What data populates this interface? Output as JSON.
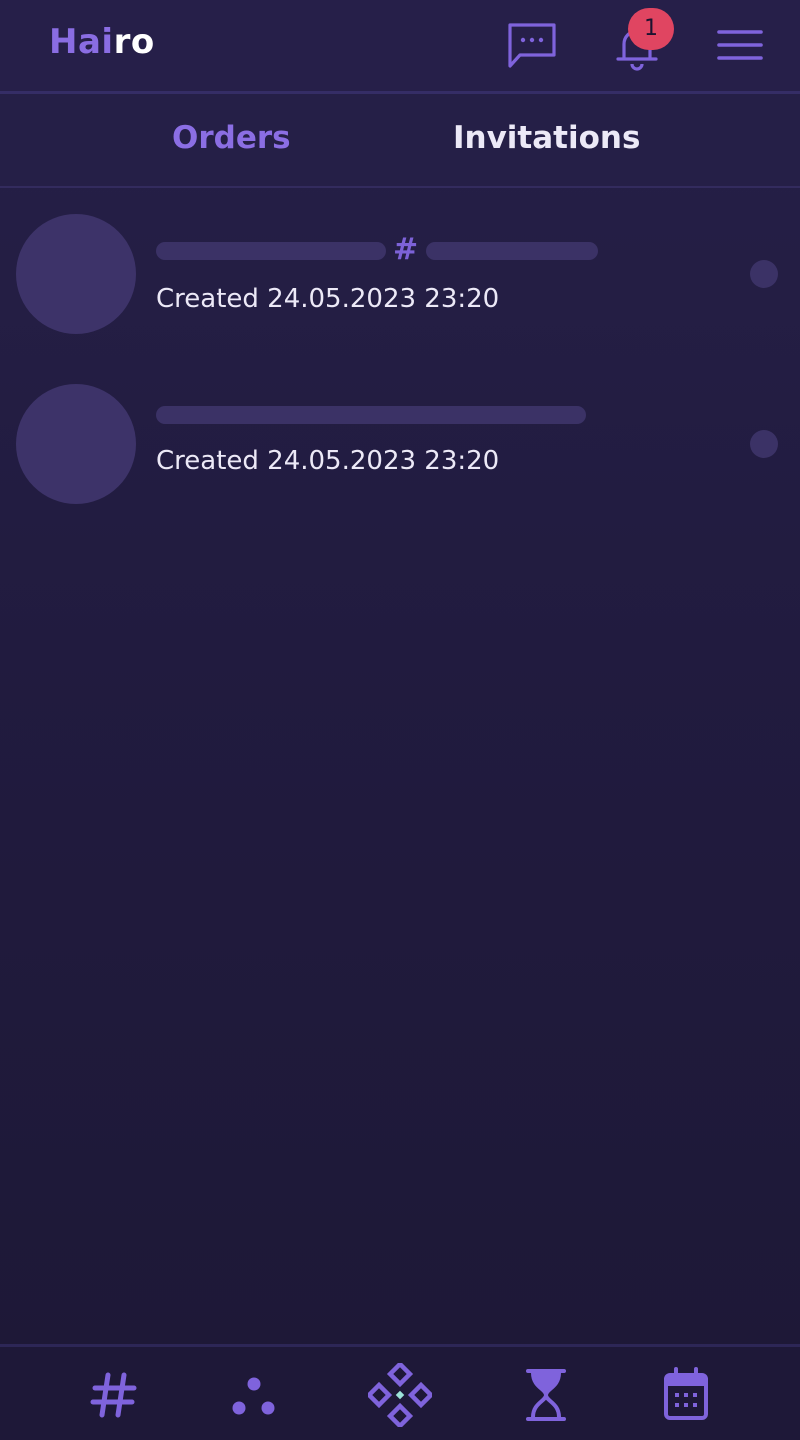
{
  "header": {
    "logo_part1": "Hai",
    "logo_part2": "ro",
    "chat_icon": "chat-bubble-icon",
    "bell_icon": "bell-icon",
    "menu_icon": "hamburger-menu-icon",
    "notification_count": "1"
  },
  "tabs": [
    {
      "label": "Orders",
      "active": true
    },
    {
      "label": "Invitations",
      "active": false
    }
  ],
  "list": {
    "items": [
      {
        "created": "Created 24.05.2023 23:20",
        "separator": "#"
      },
      {
        "created": "Created 24.05.2023 23:20"
      }
    ]
  },
  "bottom_nav": [
    {
      "icon": "hashtag-icon"
    },
    {
      "icon": "three-dots-icon"
    },
    {
      "icon": "diamond-grid-icon"
    },
    {
      "icon": "hourglass-icon"
    },
    {
      "icon": "calendar-icon"
    }
  ],
  "colors": {
    "background": "#221c42",
    "accent": "#8a6de3",
    "badge": "#e04561",
    "skeleton": "#3b3266",
    "text": "#ece9f7"
  }
}
